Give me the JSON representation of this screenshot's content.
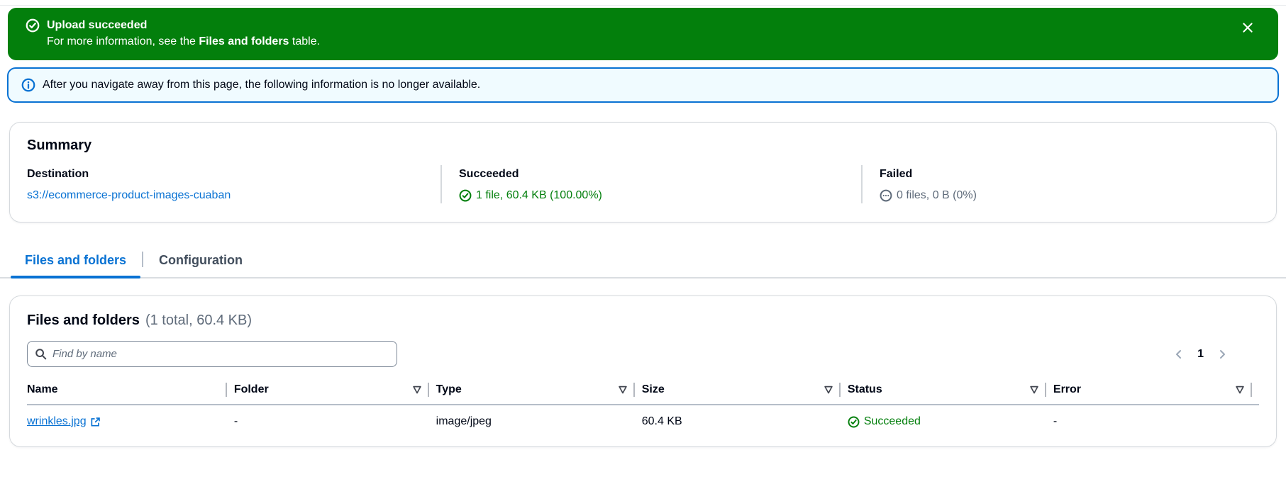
{
  "flashbar": {
    "title": "Upload succeeded",
    "message_prefix": "For more information, see the ",
    "message_bold": "Files and folders",
    "message_suffix": " table."
  },
  "alert": {
    "text": "After you navigate away from this page, the following information is no longer available."
  },
  "summary": {
    "title": "Summary",
    "destination": {
      "label": "Destination",
      "value": "s3://ecommerce-product-images-cuaban"
    },
    "succeeded": {
      "label": "Succeeded",
      "value": "1 file, 60.4 KB (100.00%)"
    },
    "failed": {
      "label": "Failed",
      "value": "0 files, 0 B (0%)"
    }
  },
  "tabs": [
    {
      "label": "Files and folders",
      "active": true
    },
    {
      "label": "Configuration",
      "active": false
    }
  ],
  "files_panel": {
    "title": "Files and folders",
    "counter": "(1 total, 60.4 KB)",
    "search_placeholder": "Find by name",
    "pagination": {
      "current_page": "1"
    },
    "table": {
      "columns": [
        "Name",
        "Folder",
        "Type",
        "Size",
        "Status",
        "Error"
      ],
      "rows": [
        {
          "name": "wrinkles.jpg",
          "folder": "-",
          "type": "image/jpeg",
          "size": "60.4 KB",
          "status": "Succeeded",
          "error": "-"
        }
      ]
    }
  },
  "colors": {
    "success_green": "#037f0c",
    "accent_blue": "#0972d3",
    "muted_gray": "#5f6b7a"
  }
}
